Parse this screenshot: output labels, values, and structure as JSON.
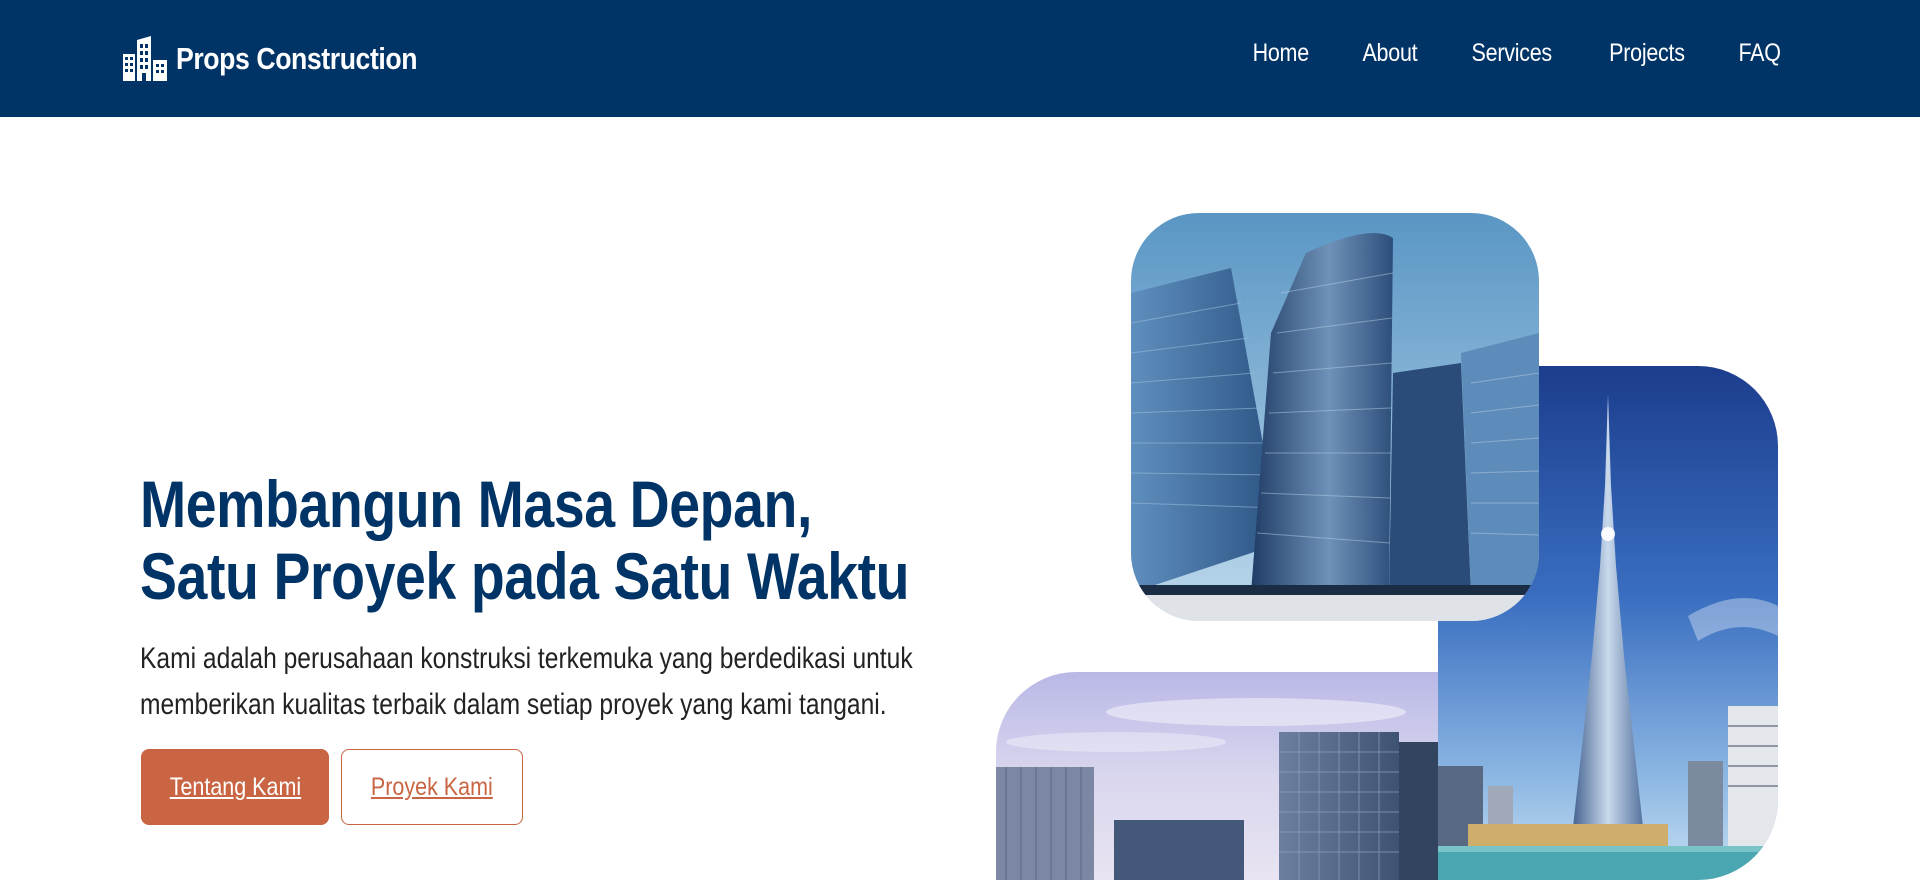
{
  "brand": {
    "name": "Props Construction",
    "icon": "buildings-icon"
  },
  "nav": {
    "items": [
      "Home",
      "About",
      "Services",
      "Projects",
      "FAQ"
    ]
  },
  "hero": {
    "title_lines": [
      "Membangun Masa Depan,",
      "Satu Proyek pada Satu Waktu"
    ],
    "description_lines": [
      "Kami adalah perusahaan konstruksi terkemuka yang berdedikasi untuk",
      "memberikan kualitas terbaik dalam setiap proyek yang kami tangani."
    ],
    "primary_button": "Tentang Kami",
    "secondary_button": "Proyek Kami"
  },
  "colors": {
    "navbar_bg": "#003366",
    "title": "#003366",
    "accent": "#c96542",
    "text": "#222222",
    "background": "#ffffff"
  }
}
